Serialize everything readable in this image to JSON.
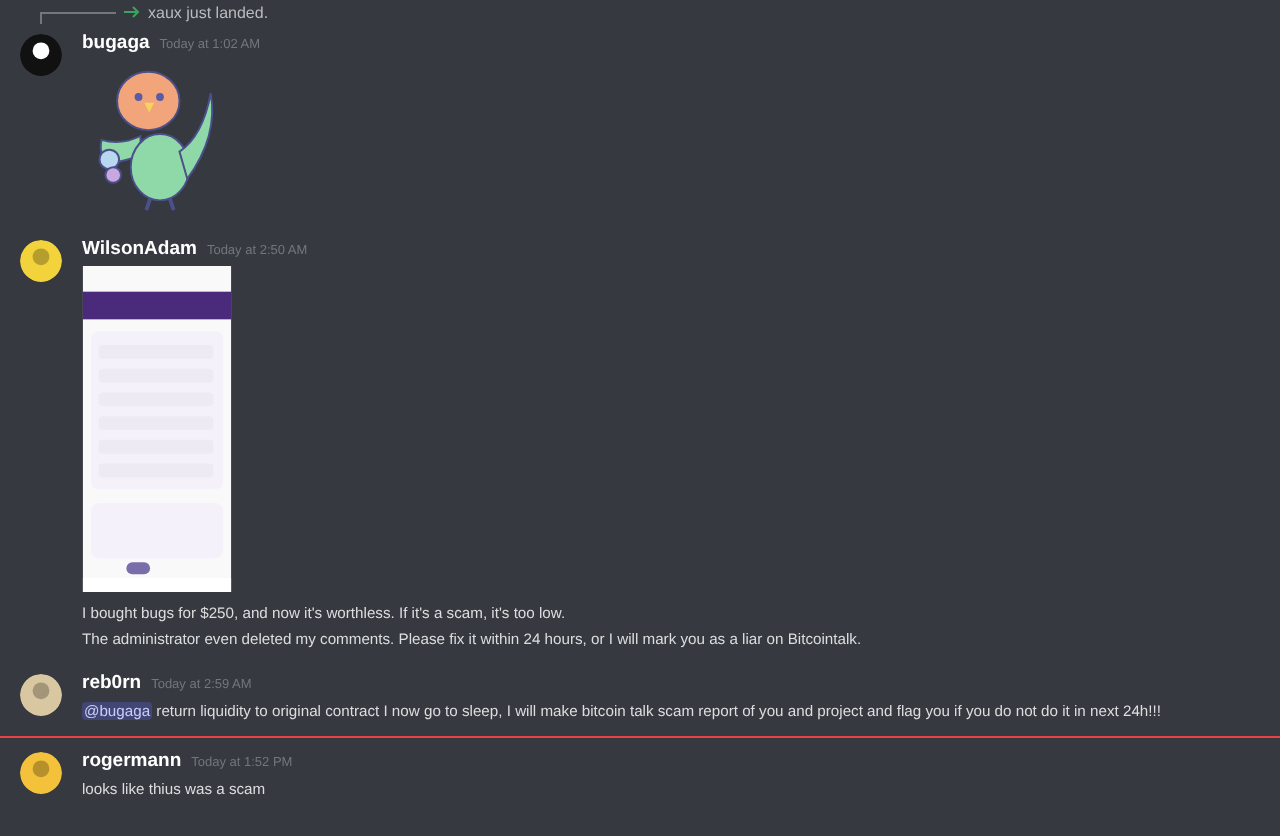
{
  "messages": [
    {
      "kind": "system",
      "text": "xaux just landed."
    },
    {
      "kind": "sticker",
      "author": "bugaga",
      "timestamp": "Today at 1:02 AM",
      "unread_divider_before": false
    },
    {
      "kind": "image",
      "author": "WilsonAdam",
      "timestamp": "Today at 2:50 AM",
      "unread_divider_before": false,
      "lines": [
        [
          {
            "kind": "text",
            "text": "I bought bugs for $250, and now it's worthless. If it's a scam, it's too low."
          }
        ],
        [
          {
            "kind": "text",
            "text": "The administrator even deleted my comments. Please fix it within 24 hours, or I will mark you as a liar on Bitcointalk."
          }
        ]
      ]
    },
    {
      "kind": "text",
      "author": "reb0rn",
      "timestamp": "Today at 2:59 AM",
      "unread_divider_before": false,
      "lines": [
        [
          {
            "kind": "mention",
            "text": "@bugaga"
          },
          {
            "kind": "text",
            "text": " return liquidity to original contract I now go to sleep, I will make bitcoin talk scam report of you and project and flag you if you do not do it in next 24h!!!"
          }
        ]
      ]
    },
    {
      "kind": "text",
      "author": "rogermann",
      "timestamp": "Today at 1:52 PM",
      "unread_divider_before": true,
      "lines": [
        [
          {
            "kind": "text",
            "text": "looks like thius was a scam"
          }
        ]
      ]
    }
  ]
}
